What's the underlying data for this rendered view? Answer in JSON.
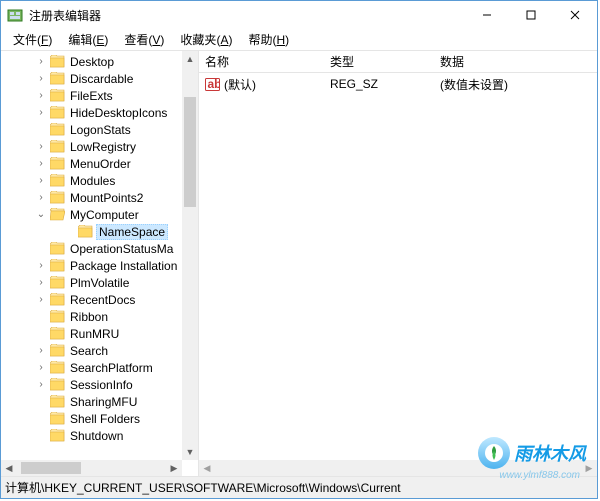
{
  "window": {
    "title": "注册表编辑器"
  },
  "menu": {
    "file": {
      "text": "文件",
      "accel": "F"
    },
    "edit": {
      "text": "编辑",
      "accel": "E"
    },
    "view": {
      "text": "查看",
      "accel": "V"
    },
    "fav": {
      "text": "收藏夹",
      "accel": "A"
    },
    "help": {
      "text": "帮助",
      "accel": "H"
    }
  },
  "tree": [
    {
      "label": "Desktop",
      "exp": "right"
    },
    {
      "label": "Discardable",
      "exp": "right"
    },
    {
      "label": "FileExts",
      "exp": "right"
    },
    {
      "label": "HideDesktopIcons",
      "exp": "right"
    },
    {
      "label": "LogonStats",
      "exp": "none"
    },
    {
      "label": "LowRegistry",
      "exp": "right"
    },
    {
      "label": "MenuOrder",
      "exp": "right"
    },
    {
      "label": "Modules",
      "exp": "right"
    },
    {
      "label": "MountPoints2",
      "exp": "right"
    },
    {
      "label": "MyComputer",
      "exp": "down",
      "open": true
    },
    {
      "label": "NameSpace",
      "exp": "none",
      "child": true,
      "selected": true
    },
    {
      "label": "OperationStatusMa",
      "exp": "none"
    },
    {
      "label": "Package Installation",
      "exp": "right"
    },
    {
      "label": "PlmVolatile",
      "exp": "right"
    },
    {
      "label": "RecentDocs",
      "exp": "right"
    },
    {
      "label": "Ribbon",
      "exp": "none"
    },
    {
      "label": "RunMRU",
      "exp": "none"
    },
    {
      "label": "Search",
      "exp": "right"
    },
    {
      "label": "SearchPlatform",
      "exp": "right"
    },
    {
      "label": "SessionInfo",
      "exp": "right"
    },
    {
      "label": "SharingMFU",
      "exp": "none"
    },
    {
      "label": "Shell Folders",
      "exp": "none"
    },
    {
      "label": "Shutdown",
      "exp": "none"
    }
  ],
  "columns": {
    "name": "名称",
    "type": "类型",
    "data": "数据"
  },
  "rows": [
    {
      "name": "(默认)",
      "type": "REG_SZ",
      "data": "(数值未设置)"
    }
  ],
  "status": "计算机\\HKEY_CURRENT_USER\\SOFTWARE\\Microsoft\\Windows\\Current",
  "watermark": {
    "text": "雨林木风",
    "url": "www.ylmf888.com"
  }
}
